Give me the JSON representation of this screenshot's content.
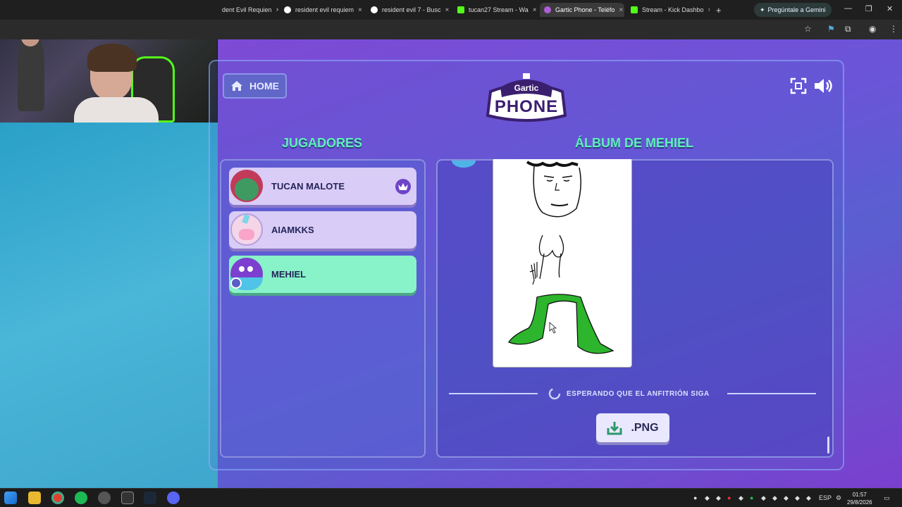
{
  "browser": {
    "tabs": [
      {
        "title": "dent Evil Requien",
        "favicon_color": "#cccccc"
      },
      {
        "title": "resident evil requiem",
        "favicon_color": "#ffffff"
      },
      {
        "title": "resident evil 7 - Busc",
        "favicon_color": "#ffffff"
      },
      {
        "title": "tucan27 Stream - Wa",
        "favicon_color": "#53fc18"
      },
      {
        "title": "Gartic Phone - Teléfo",
        "favicon_color": "#b05dd8"
      },
      {
        "title": "Stream - Kick Dashbo",
        "favicon_color": "#53fc18"
      }
    ],
    "new_tab": "+",
    "gemini_label": "Pregúntale a Gemini",
    "close_tab": "×"
  },
  "game": {
    "home_label": "HOME",
    "logo_top": "Gartic",
    "logo_bottom": "PHONE",
    "players_title": "JUGADORES",
    "album_title": "ÁLBUM DE MEHIEL",
    "players": [
      {
        "name": "TUCAN MALOTE",
        "host": true,
        "avatar_color": "#3f9a62"
      },
      {
        "name": "AIAMKKS",
        "host": false,
        "avatar_color": "#f4d6e8"
      },
      {
        "name": "MEHIEL",
        "host": false,
        "avatar_color": "#7c3fd0"
      }
    ],
    "waiting_text": "ESPERANDO QUE EL ANFITRIÓN SIGA",
    "png_label": ".PNG"
  },
  "taskbar": {
    "language": "ESP",
    "time": "01:57",
    "date": "29/8/2026"
  },
  "colors": {
    "accent_green": "#5ef0b8",
    "panel_purple": "#6166c9",
    "drawing_green": "#2db52d"
  }
}
